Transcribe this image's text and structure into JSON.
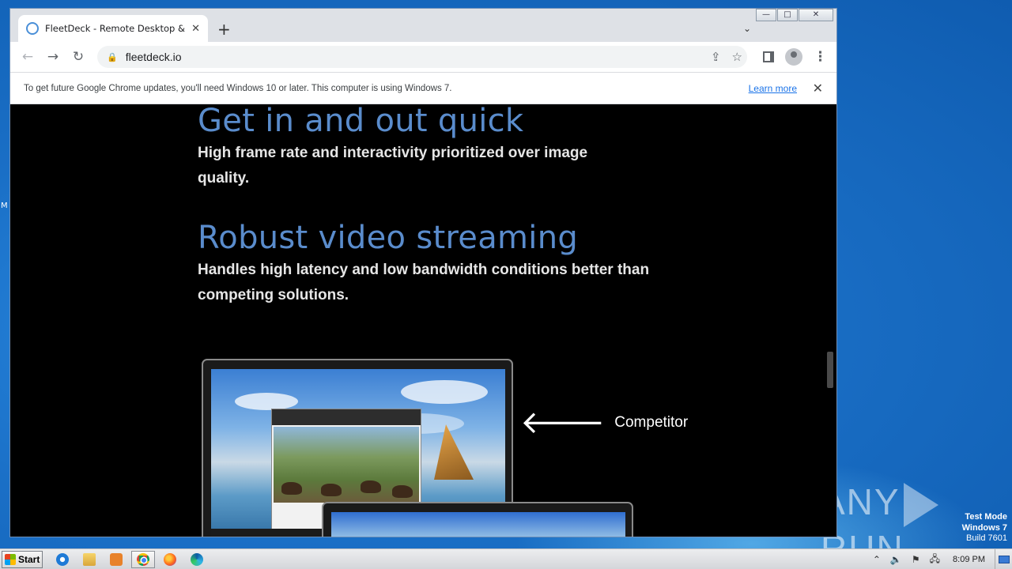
{
  "desktop": {
    "edge_text": "M",
    "watermark": "ANY RUN",
    "watermark_left": "ANY",
    "watermark_right": "RUN",
    "testmode": {
      "line1": "Test Mode",
      "line2": "Windows 7",
      "line3": "Build 7601"
    }
  },
  "window_controls": {
    "minimize": "—",
    "maximize": "□",
    "close": "✕"
  },
  "browser": {
    "tab": {
      "title": "FleetDeck - Remote Desktop & Virtua",
      "close": "✕"
    },
    "new_tab": "+",
    "tab_search": "⌄",
    "nav": {
      "back": "←",
      "forward": "→",
      "reload": "↻"
    },
    "omnibox": {
      "lock": "🔒",
      "url": "fleetdeck.io",
      "share_icon": "⇪",
      "star_icon": "☆"
    },
    "menu_icon": "⋮",
    "infobar": {
      "text": "To get future Google Chrome updates, you'll need Windows 10 or later. This computer is using Windows 7.",
      "link": "Learn more",
      "close": "✕"
    }
  },
  "page": {
    "section1": {
      "heading": "Get in and out quick",
      "body": "High frame rate and interactivity prioritized over image quality."
    },
    "section2": {
      "heading": "Robust video streaming",
      "body": "Handles high latency and low bandwidth conditions better than competing solutions."
    },
    "comparison": {
      "arrow": "🡐",
      "label": "Competitor"
    }
  },
  "taskbar": {
    "start_label": "Start",
    "apps": [
      "internet-explorer",
      "file-explorer",
      "media-player",
      "chrome",
      "firefox",
      "edge"
    ],
    "tray": {
      "chevron": "⌃",
      "volume": "🔈",
      "flag": "⚑",
      "network": "🖧",
      "clock": "8:09 PM"
    }
  },
  "colors": {
    "heading": "#5a8ccc",
    "page_bg": "#000000",
    "link": "#1a73e8"
  }
}
